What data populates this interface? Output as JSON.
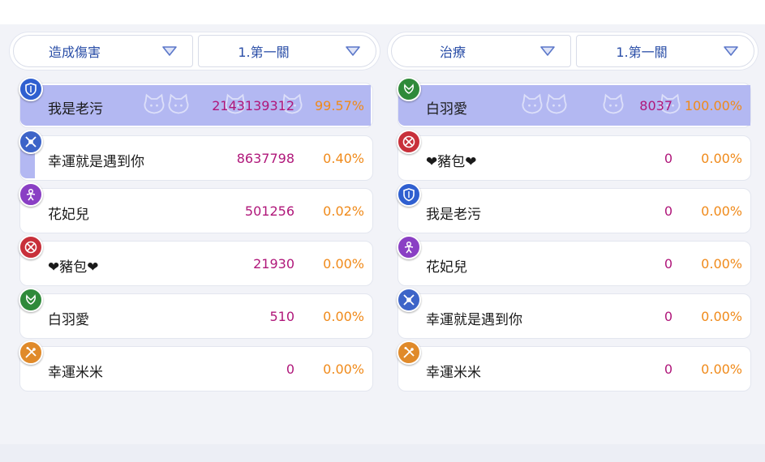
{
  "colors": {
    "accent_text": "#2a4ea7",
    "value_text": "#b0177a",
    "percent_text": "#f08a1a",
    "bar_fill": "#b3b8f2"
  },
  "left_panel": {
    "type_select": "造成傷害",
    "stage_select": "1.第一關",
    "rows": [
      {
        "name": "我是老污",
        "value": "2143139312",
        "percent": "99.57%",
        "bar_fraction": 0.9957,
        "badge_color": "#2f5fd0",
        "badge_icon": "shield-icon"
      },
      {
        "name": "幸運就是遇到你",
        "value": "8637798",
        "percent": "0.40%",
        "bar_fraction": 0.04,
        "badge_color": "#3d64c8",
        "badge_icon": "crossed-spears-icon"
      },
      {
        "name": "花妃兒",
        "value": "501256",
        "percent": "0.02%",
        "bar_fraction": 0.0,
        "badge_color": "#8a3fc4",
        "badge_icon": "dancer-icon"
      },
      {
        "name": "❤豬包❤",
        "value": "21930",
        "percent": "0.00%",
        "bar_fraction": 0.0,
        "badge_color": "#c8303a",
        "badge_icon": "crossed-axes-icon"
      },
      {
        "name": "白羽愛",
        "value": "510",
        "percent": "0.00%",
        "bar_fraction": 0.0,
        "badge_color": "#2f8a3a",
        "badge_icon": "wings-icon"
      },
      {
        "name": "幸運米米",
        "value": "0",
        "percent": "0.00%",
        "bar_fraction": 0.0,
        "badge_color": "#e08a2a",
        "badge_icon": "crossed-swords-icon"
      }
    ]
  },
  "right_panel": {
    "type_select": "治療",
    "stage_select": "1.第一關",
    "rows": [
      {
        "name": "白羽愛",
        "value": "8037",
        "percent": "100.00%",
        "bar_fraction": 1.0,
        "badge_color": "#2f8a3a",
        "badge_icon": "wings-icon"
      },
      {
        "name": "❤豬包❤",
        "value": "0",
        "percent": "0.00%",
        "bar_fraction": 0.0,
        "badge_color": "#c8303a",
        "badge_icon": "crossed-axes-icon"
      },
      {
        "name": "我是老污",
        "value": "0",
        "percent": "0.00%",
        "bar_fraction": 0.0,
        "badge_color": "#2f5fd0",
        "badge_icon": "shield-icon"
      },
      {
        "name": "花妃兒",
        "value": "0",
        "percent": "0.00%",
        "bar_fraction": 0.0,
        "badge_color": "#8a3fc4",
        "badge_icon": "dancer-icon"
      },
      {
        "name": "幸運就是遇到你",
        "value": "0",
        "percent": "0.00%",
        "bar_fraction": 0.0,
        "badge_color": "#3d64c8",
        "badge_icon": "crossed-spears-icon"
      },
      {
        "name": "幸運米米",
        "value": "0",
        "percent": "0.00%",
        "bar_fraction": 0.0,
        "badge_color": "#e08a2a",
        "badge_icon": "crossed-swords-icon"
      }
    ]
  }
}
